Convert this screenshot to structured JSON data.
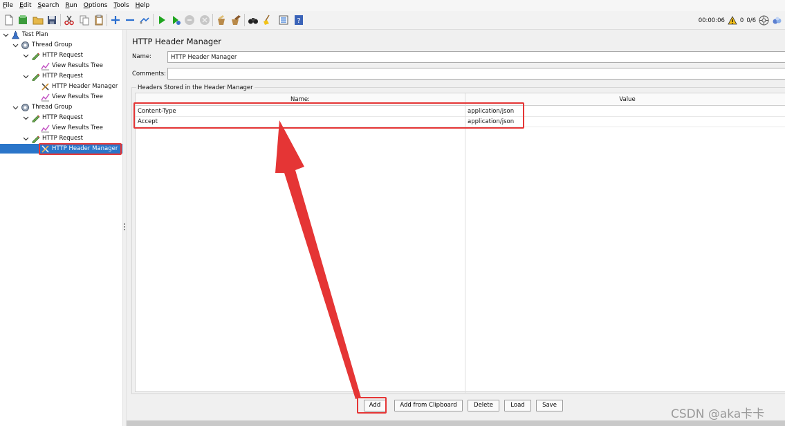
{
  "menu": [
    {
      "mnemonic": "F",
      "rest": "ile"
    },
    {
      "mnemonic": "E",
      "rest": "dit"
    },
    {
      "mnemonic": "S",
      "rest": "earch"
    },
    {
      "mnemonic": "R",
      "rest": "un"
    },
    {
      "mnemonic": "O",
      "rest": "ptions"
    },
    {
      "mnemonic": "T",
      "rest": "ools"
    },
    {
      "mnemonic": "H",
      "rest": "elp"
    }
  ],
  "status": {
    "elapsed": "00:00:06",
    "warnings": "0",
    "threads": "0/6"
  },
  "tree": [
    {
      "label": "Test Plan",
      "icon": "test-plan-icon"
    },
    {
      "label": "Thread Group",
      "icon": "thread-group-gear-icon"
    },
    {
      "label": "HTTP Request",
      "icon": "http-request-pen-icon"
    },
    {
      "label": "View Results Tree",
      "icon": "results-tree-icon"
    },
    {
      "label": "HTTP Request",
      "icon": "http-request-pen-icon"
    },
    {
      "label": "HTTP Header Manager",
      "icon": "header-manager-tools-icon"
    },
    {
      "label": "View Results Tree",
      "icon": "results-tree-icon"
    },
    {
      "label": "Thread Group",
      "icon": "thread-group-gear-icon"
    },
    {
      "label": "HTTP Request",
      "icon": "http-request-pen-icon"
    },
    {
      "label": "View Results Tree",
      "icon": "results-tree-icon"
    },
    {
      "label": "HTTP Request",
      "icon": "http-request-pen-icon"
    },
    {
      "label": "HTTP Header Manager",
      "icon": "header-manager-tools-icon"
    }
  ],
  "panel": {
    "title": "HTTP Header Manager",
    "name_label": "Name:",
    "name_value": "HTTP Header Manager",
    "comments_label": "Comments:",
    "comments_value": "",
    "group_title": "Headers Stored in the Header Manager",
    "columns": [
      "Name:",
      "Value"
    ],
    "rows": [
      {
        "name": "Content-Type",
        "value": "application/json"
      },
      {
        "name": "Accept",
        "value": "application/json"
      }
    ]
  },
  "buttons": {
    "add": "Add",
    "add_from_clipboard": "Add from Clipboard",
    "delete": "Delete",
    "load": "Load",
    "save": "Save"
  },
  "watermark": "CSDN @aka卡卡",
  "colors": {
    "selection": "#2a75c9",
    "annotation": "#e53535"
  }
}
